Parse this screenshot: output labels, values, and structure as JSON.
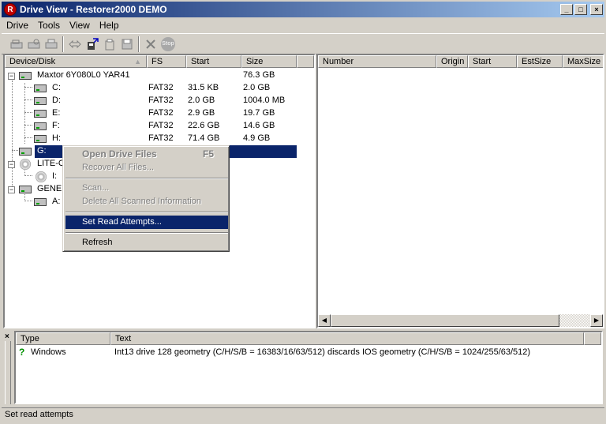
{
  "window": {
    "title": "Drive View - Restorer2000 DEMO",
    "app_icon_glyph": "R"
  },
  "title_buttons": {
    "minimize": "_",
    "maximize": "□",
    "close": "×"
  },
  "menu": [
    "Drive",
    "Tools",
    "View",
    "Help"
  ],
  "toolbar_icons": [
    "drive-open-icon",
    "scan-icon",
    "print-icon",
    "swap-icon",
    "copy-drive-icon",
    "paste-icon",
    "save-icon",
    "delete-icon",
    "stop-icon"
  ],
  "toolbar": {
    "stop_label": "Stop"
  },
  "left_pane": {
    "columns": [
      "Device/Disk",
      "FS",
      "Start",
      "Size"
    ],
    "rows": [
      {
        "name": "Maxtor 6Y080L0 YAR41",
        "fs": "",
        "start": "",
        "size": "76.3 GB"
      },
      {
        "name": "C:",
        "fs": "FAT32",
        "start": "31.5 KB",
        "size": "2.0 GB"
      },
      {
        "name": "D:",
        "fs": "FAT32",
        "start": "2.0 GB",
        "size": "1004.0 MB"
      },
      {
        "name": "E:",
        "fs": "FAT32",
        "start": "2.9 GB",
        "size": "19.7 GB"
      },
      {
        "name": "F:",
        "fs": "FAT32",
        "start": "22.6 GB",
        "size": "14.6 GB"
      },
      {
        "name": "H:",
        "fs": "FAT32",
        "start": "71.4 GB",
        "size": "4.9 GB"
      },
      {
        "name": "G:",
        "fs": "",
        "start": "",
        "size": ""
      },
      {
        "name": "LITE-C",
        "fs": "",
        "start": "",
        "size": ""
      },
      {
        "name": "I:",
        "fs": "",
        "start": "",
        "size": ""
      },
      {
        "name": "GENEI",
        "fs": "",
        "start": "",
        "size": ""
      },
      {
        "name": "A:",
        "fs": "",
        "start": "",
        "size": ""
      }
    ]
  },
  "right_pane": {
    "columns": [
      "Number",
      "Origin",
      "Start",
      "EstSize",
      "MaxSize"
    ]
  },
  "context_menu": {
    "items": [
      {
        "label": "Open Drive Files",
        "shortcut": "F5"
      },
      {
        "label": "Recover All Files..."
      },
      {
        "label": "Scan..."
      },
      {
        "label": "Delete All Scanned Information"
      },
      {
        "label": "Set Read Attempts..."
      },
      {
        "label": "Refresh"
      }
    ]
  },
  "log": {
    "close_glyph": "×",
    "columns": [
      "Type",
      "Text"
    ],
    "rows": [
      {
        "icon": "?",
        "type": "Windows",
        "text": "Int13 drive 128 geometry (C/H/S/B = 16383/16/63/512) discards IOS geometry (C/H/S/B = 1024/255/63/512)"
      }
    ]
  },
  "statusbar": {
    "text": "Set read attempts"
  }
}
